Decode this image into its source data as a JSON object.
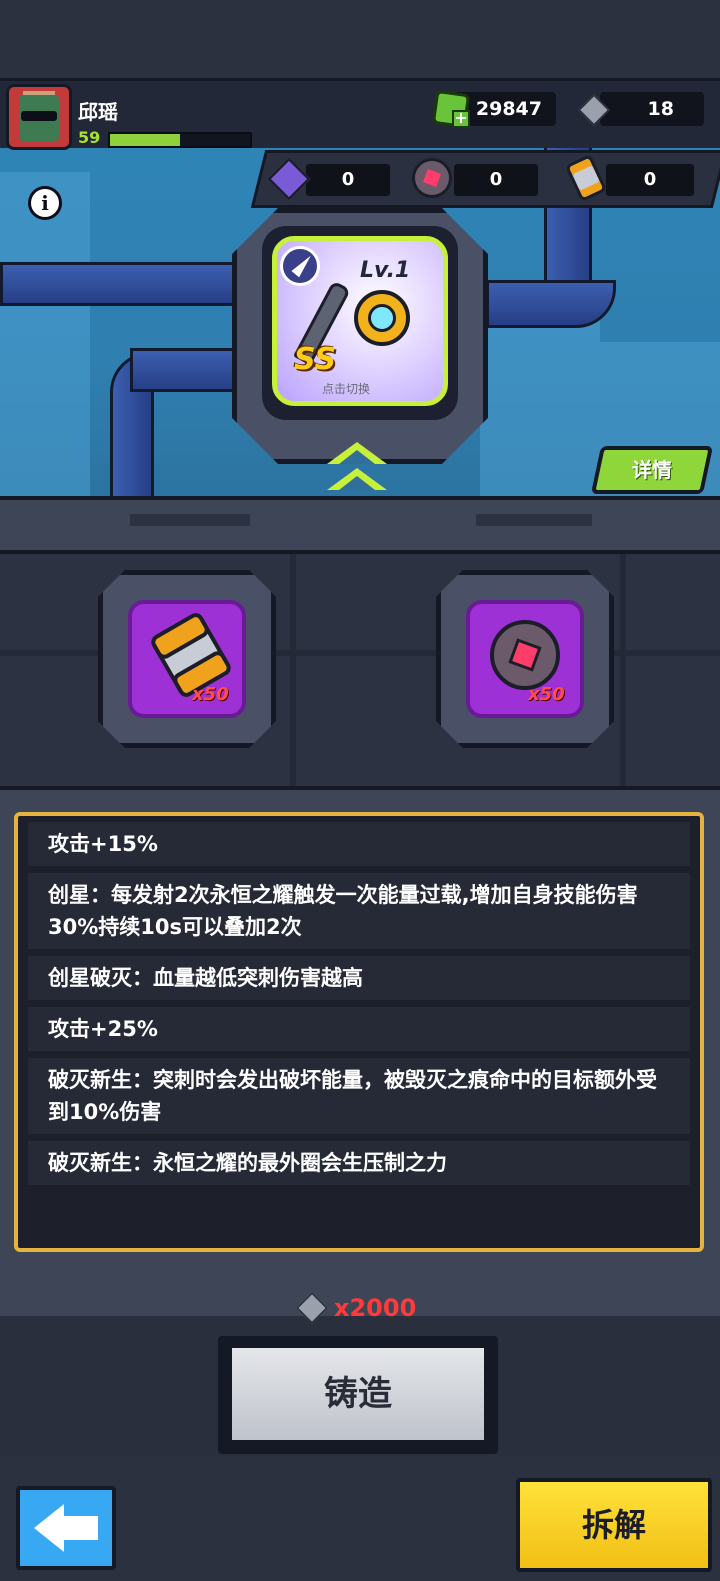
{
  "player": {
    "name": "邱瑶",
    "level": "59",
    "xp_fraction": 0.5
  },
  "currency": {
    "gems": "29847",
    "cubes": "18"
  },
  "materials": [
    {
      "icon": "purple-crystal-icon",
      "count": "0"
    },
    {
      "icon": "red-orb-icon",
      "count": "0"
    },
    {
      "icon": "orange-cylinder-icon",
      "count": "0"
    }
  ],
  "item": {
    "level_label": "Lv.1",
    "grade": "SS",
    "caption": "点击切换"
  },
  "buttons": {
    "detail": "详情",
    "forge": "铸造",
    "dismantle": "拆解"
  },
  "slots": [
    {
      "icon": "orange-cylinder-icon",
      "qty": "x50"
    },
    {
      "icon": "red-orb-icon",
      "qty": "x50"
    }
  ],
  "effects": [
    "攻击+15%",
    "创星：每发射2次永恒之耀触发一次能量过载,增加自身技能伤害30%持续10s可以叠加2次",
    "创星破灭：血量越低突刺伤害越高",
    "攻击+25%",
    "破灭新生：突刺时会发出破坏能量，被毁灭之痕命中的目标额外受到10%伤害",
    "破灭新生：永恒之耀的最外圈会生压制之力"
  ],
  "cost": {
    "amount": "x2000"
  },
  "colors": {
    "accent_green": "#8ed63a",
    "panel_border": "#e6b33e",
    "slot_purple": "#9d31d6",
    "cost_red": "#ff3a3a"
  }
}
